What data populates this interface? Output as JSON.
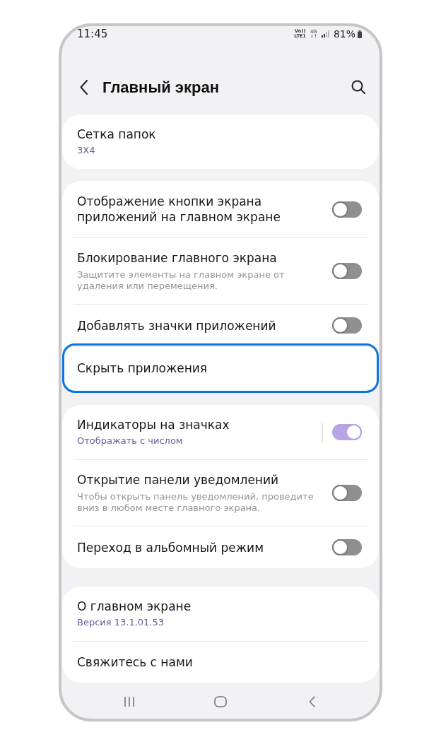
{
  "status_bar": {
    "time": "11:45",
    "indicators": [
      {
        "kind": "volte",
        "top": "Vo))",
        "bottom": "LTE1"
      },
      {
        "kind": "data",
        "top": "4G",
        "bottom": "↓↑"
      }
    ],
    "battery": "81%"
  },
  "header": {
    "title": "Главный экран"
  },
  "groups": [
    {
      "items": [
        {
          "kind": "link",
          "title": "Сетка папок",
          "summary": "3X4",
          "highlighted": false
        }
      ]
    },
    {
      "items": [
        {
          "kind": "switch",
          "title": "Отображение кнопки экрана приложений на главном экране",
          "on": false,
          "split": false,
          "highlighted": false
        },
        {
          "kind": "switch",
          "title": "Блокирование главного экрана",
          "description": "Защитите элементы на главном экране от удаления или перемещения.",
          "on": false,
          "split": false,
          "highlighted": false
        },
        {
          "kind": "switch",
          "title": "Добавлять значки приложений",
          "on": false,
          "split": false,
          "highlighted": false
        },
        {
          "kind": "link",
          "title": "Скрыть приложения",
          "highlighted": true
        }
      ]
    },
    {
      "items": [
        {
          "kind": "switch",
          "title": "Индикаторы на значках",
          "summary": "Отображать с числом",
          "on": true,
          "split": true,
          "highlighted": false
        },
        {
          "kind": "switch",
          "title": "Открытие панели уведомлений",
          "description": "Чтобы открыть панель уведомлений, проведите вниз в любом месте главного экрана.",
          "on": false,
          "split": false,
          "highlighted": false
        },
        {
          "kind": "switch",
          "title": "Переход в альбомный режим",
          "on": false,
          "split": false,
          "highlighted": false
        }
      ]
    },
    {
      "items": [
        {
          "kind": "link",
          "title": "О главном экране",
          "summary": "Версия 13.1.01.53",
          "highlighted": false
        },
        {
          "kind": "link",
          "title": "Свяжитесь с нами",
          "highlighted": false
        }
      ]
    }
  ]
}
